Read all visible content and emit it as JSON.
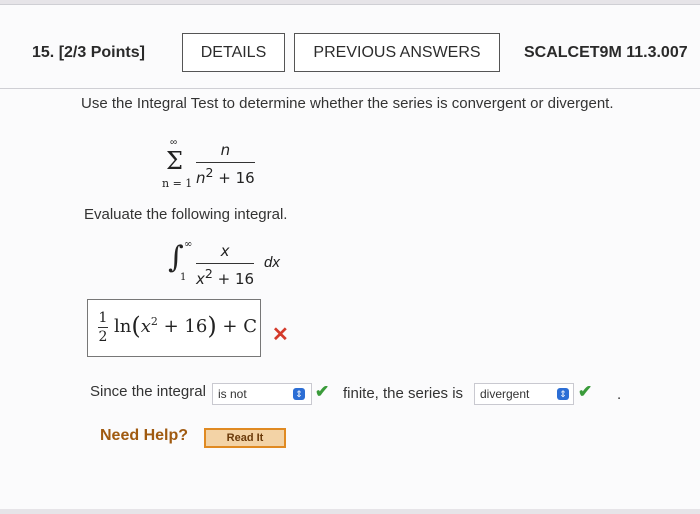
{
  "question": {
    "number": "15.",
    "points": "[2/3 Points]",
    "details_label": "DETAILS",
    "previous_answers_label": "PREVIOUS ANSWERS",
    "course_code": "SCALCET9M 11.3.007"
  },
  "prompt": "Use the Integral Test to determine whether the series is convergent or divergent.",
  "series": {
    "upper": "∞",
    "symbol": "Σ",
    "lower": "n = 1",
    "numerator": "n",
    "denominator_var": "n",
    "denominator_exp": "2",
    "denominator_rest": " + 16"
  },
  "evaluate_text": "Evaluate the following integral.",
  "integral": {
    "upper": "∞",
    "lower": "1",
    "numerator": "x",
    "denominator_var": "x",
    "denominator_exp": "2",
    "denominator_rest": " + 16",
    "differential": "dx"
  },
  "answer": {
    "coef_num": "1",
    "coef_den": "2",
    "func": "ln",
    "var": "x",
    "exp": "2",
    "rest": " + 16",
    "constant": " + C",
    "status": "incorrect"
  },
  "conclusion": {
    "lead": "Since the integral",
    "select1_value": "is not",
    "middle": "finite, the series is",
    "select2_value": "divergent",
    "end": "."
  },
  "help": {
    "label": "Need Help?",
    "read_it": "Read It"
  },
  "colors": {
    "correct": "#3a9b3a",
    "incorrect": "#d43a2b",
    "select_button": "#2c6ed5"
  }
}
